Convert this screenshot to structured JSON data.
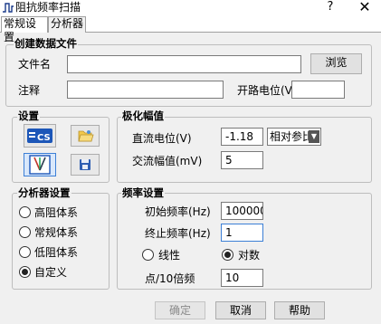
{
  "window": {
    "title": "阻抗频率扫描",
    "help_label": "?",
    "close_label": "✕",
    "icon": "waveform-icon"
  },
  "tabs": [
    {
      "label": "常规设置",
      "active": true
    },
    {
      "label": "分析器",
      "active": false
    }
  ],
  "create_file": {
    "title": "创建数据文件",
    "filename_label": "文件名",
    "filename_value": "",
    "browse_label": "浏览",
    "comment_label": "注释",
    "comment_value": "",
    "ocp_label": "开路电位(V)",
    "ocp_value": ""
  },
  "settings": {
    "title": "设置",
    "icons": [
      "cs-device-icon",
      "open-folder-icon",
      "electrode-cell-icon",
      "save-disk-icon"
    ],
    "selected_icon": "electrode-cell-icon",
    "cs_icon_text": "CS"
  },
  "polarization": {
    "title": "极化幅值",
    "dc_label": "直流电位(V)",
    "dc_value": "-1.18",
    "ref_select": "相对参比",
    "ac_label": "交流幅值(mV)",
    "ac_value": "5"
  },
  "analyzer": {
    "title": "分析器设置",
    "options": [
      {
        "label": "高阻体系",
        "checked": false
      },
      {
        "label": "常规体系",
        "checked": false
      },
      {
        "label": "低阻体系",
        "checked": false
      },
      {
        "label": "自定义",
        "checked": true
      }
    ]
  },
  "frequency": {
    "title": "频率设置",
    "start_label": "初始频率(Hz)",
    "start_value": "100000",
    "end_label": "终止频率(Hz)",
    "end_value": "1",
    "linear_label": "线性",
    "log_label": "对数",
    "scale": "log",
    "points_label": "点/10倍频",
    "points_value": "10"
  },
  "footer": {
    "ok_label": "确定",
    "cancel_label": "取消",
    "help_label": "帮助"
  }
}
